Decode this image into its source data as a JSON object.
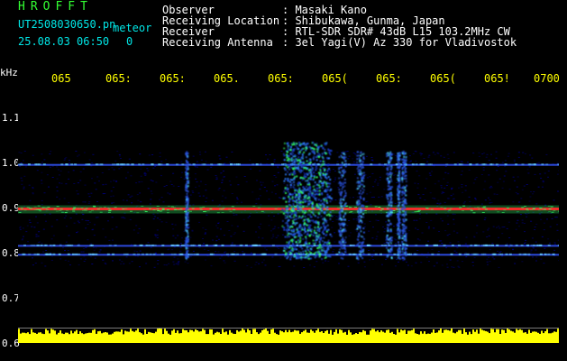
{
  "header": {
    "brand": "HROFFT",
    "filename": "UT2508030650.pn",
    "meteor_label": "meteor",
    "datetime": "25.08.03 06:50",
    "count": "0",
    "info_rows": [
      {
        "label": "Observer",
        "value": ": Masaki Kano"
      },
      {
        "label": "Receiving Location",
        "value": ": Shibukawa, Gunma, Japan"
      },
      {
        "label": "Receiver",
        "value": ": RTL-SDR SDR# 43dB L15 103.2MHz CW"
      },
      {
        "label": "Receiving Antenna",
        "value": ": 3el Yagi(V) Az 330 for Vladivostok"
      }
    ]
  },
  "axis": {
    "y_unit": "kHz",
    "y_ticks": [
      "1.1",
      "1.0",
      "0.9",
      "0.8",
      "0.7",
      "0.6"
    ],
    "time_ticks": [
      "065",
      "065:",
      "065:",
      "065.",
      "065:",
      "065(",
      "065:",
      "065(",
      "065!",
      "0700"
    ]
  },
  "colors": {
    "background": "#000000",
    "noise_floor": "#000080",
    "grid": "#1a1a8c",
    "carrier": "#ff2a2a",
    "signal_green": "#33ff66",
    "amplitude": "#ffff00"
  },
  "spectrogram": {
    "y_range_khz": [
      0.6,
      1.15
    ],
    "carrier_khz": 0.89,
    "secondary_lines_khz": [
      0.99,
      0.81,
      0.79
    ],
    "echo_band_khz": [
      0.8,
      1.0
    ]
  }
}
